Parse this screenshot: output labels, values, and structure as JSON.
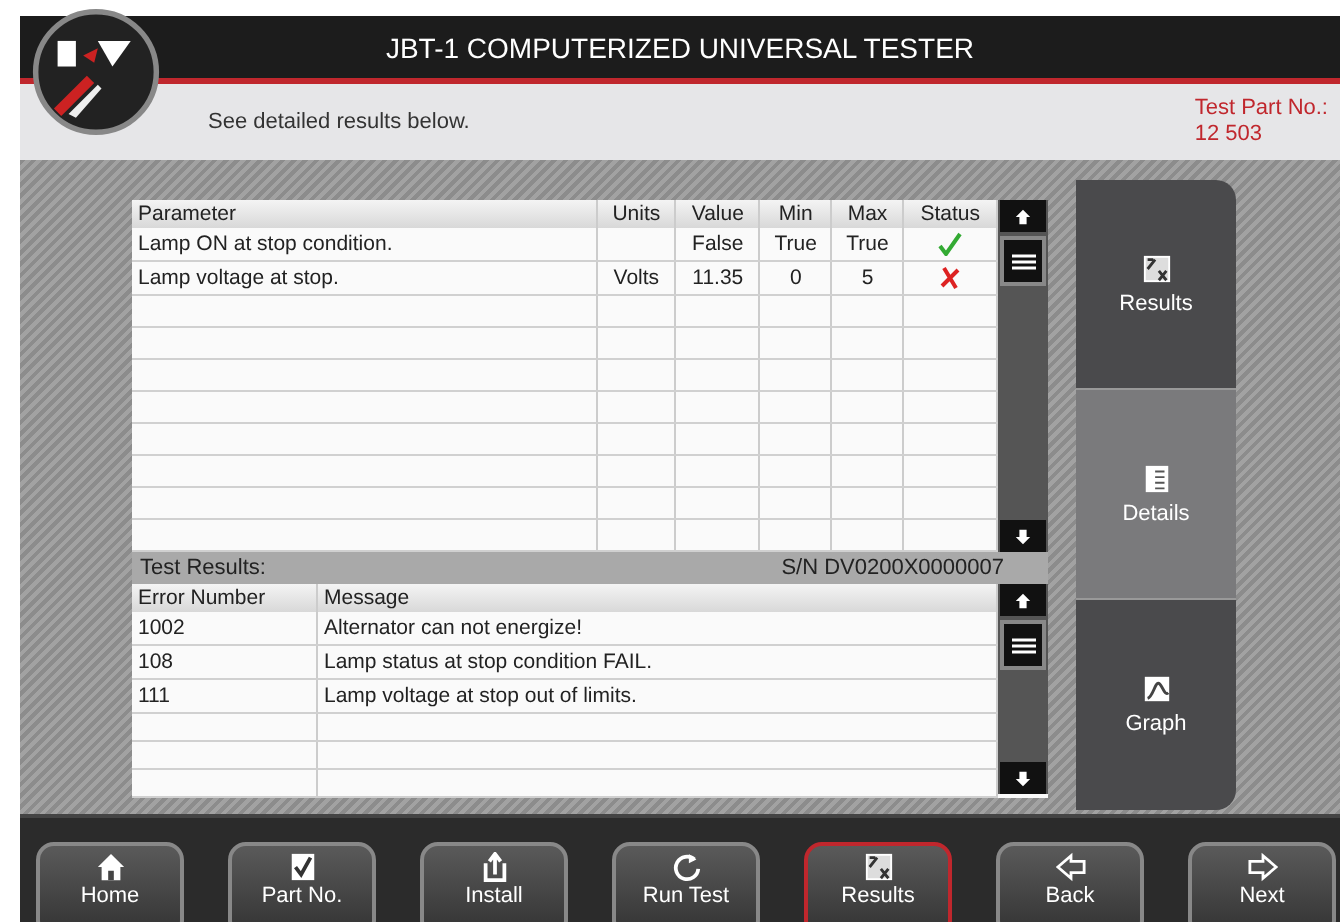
{
  "header": {
    "title": "JBT-1 COMPUTERIZED UNIVERSAL TESTER",
    "message": "See detailed results below.",
    "part_label": "Test Part No.:",
    "part_number": "12 503"
  },
  "parameters": {
    "columns": [
      "Parameter",
      "Units",
      "Value",
      "Min",
      "Max",
      "Status"
    ],
    "rows": [
      {
        "parameter": "Lamp ON at stop condition.",
        "units": "",
        "value": "False",
        "min": "True",
        "max": "True",
        "passed": true
      },
      {
        "parameter": "Lamp voltage at stop.",
        "units": "Volts",
        "value": "11.35",
        "min": "0",
        "max": "5",
        "passed": false
      }
    ]
  },
  "test_results": {
    "title": "Test Results:",
    "serial": "S/N DV0200X0000007",
    "columns": [
      "Error Number",
      "Message"
    ],
    "rows": [
      {
        "number": "1002",
        "message": "Alternator can not energize!"
      },
      {
        "number": "108",
        "message": "Lamp status at stop condition FAIL."
      },
      {
        "number": "111",
        "message": "Lamp voltage at stop out of limits."
      }
    ]
  },
  "side_tabs": [
    {
      "label": "Results",
      "kind": "results",
      "selected": false
    },
    {
      "label": "Details",
      "kind": "details",
      "selected": true
    },
    {
      "label": "Graph",
      "kind": "graph",
      "selected": false
    }
  ],
  "buttons": [
    {
      "label": "Home",
      "kind": "home",
      "selected": false
    },
    {
      "label": "Part No.",
      "kind": "part",
      "selected": false
    },
    {
      "label": "Install",
      "kind": "install",
      "selected": false
    },
    {
      "label": "Run Test",
      "kind": "run",
      "selected": false
    },
    {
      "label": "Results",
      "kind": "results",
      "selected": true
    },
    {
      "label": "Back",
      "kind": "back",
      "selected": false
    },
    {
      "label": "Next",
      "kind": "next",
      "selected": false
    }
  ]
}
